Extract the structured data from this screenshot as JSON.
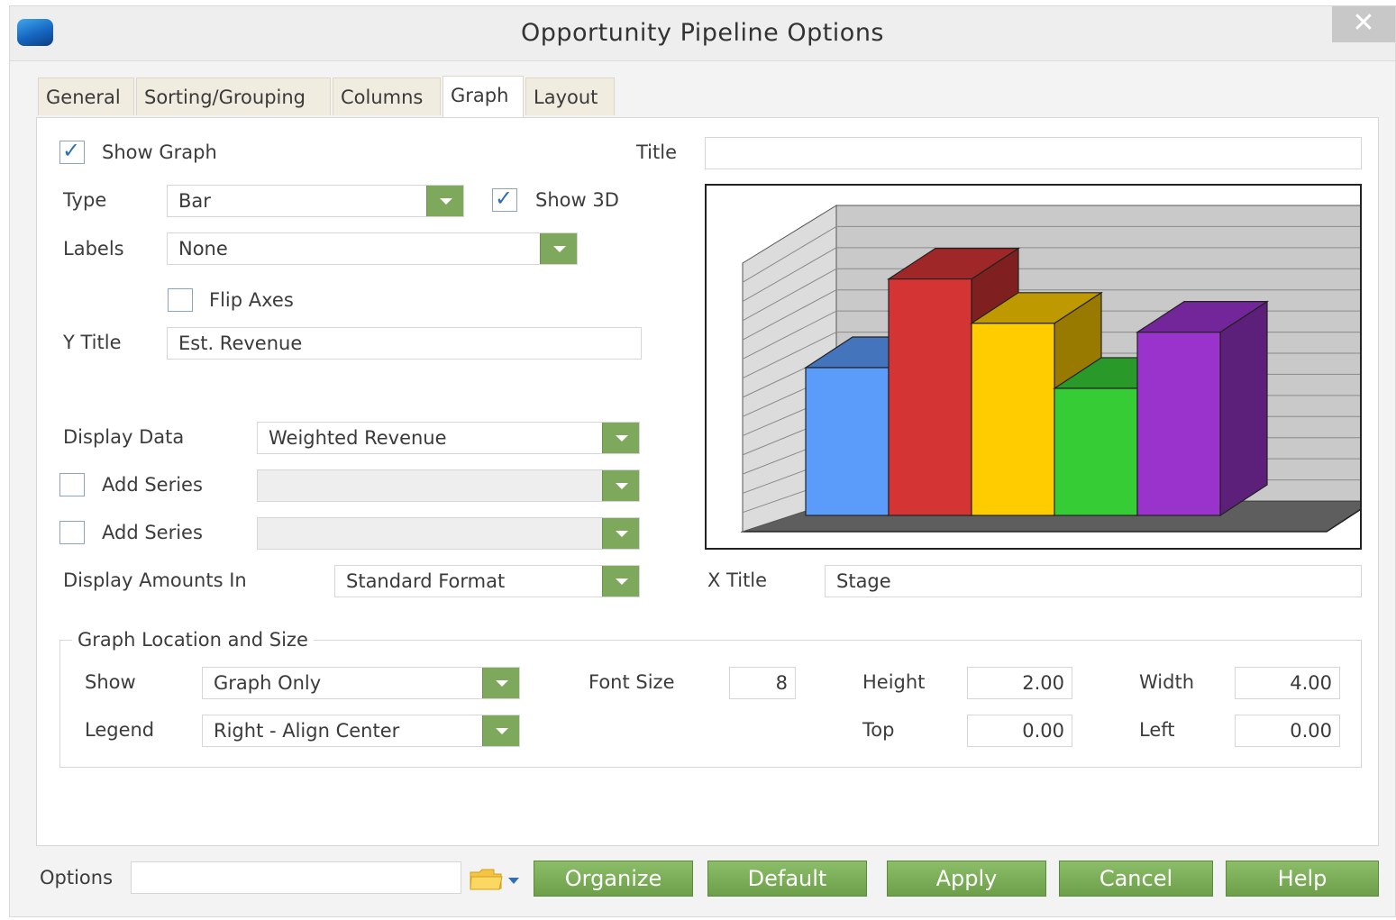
{
  "window": {
    "title": "Opportunity Pipeline Options",
    "close_glyph": "✕",
    "app_icon": "app-logo-icon"
  },
  "tabs": [
    {
      "label": "General",
      "active": false
    },
    {
      "label": "Sorting/Grouping",
      "active": false
    },
    {
      "label": "Columns",
      "active": false
    },
    {
      "label": "Graph",
      "active": true
    },
    {
      "label": "Layout",
      "active": false
    }
  ],
  "graph": {
    "show_graph_label": "Show Graph",
    "show_graph_checked": true,
    "title_label": "Title",
    "title_value": "",
    "type_label": "Type",
    "type_value": "Bar",
    "show3d_label": "Show 3D",
    "show3d_checked": true,
    "labels_label": "Labels",
    "labels_value": "None",
    "flip_axes_label": "Flip Axes",
    "flip_axes_checked": false,
    "ytitle_label": "Y Title",
    "ytitle_value": "Est. Revenue",
    "display_data_label": "Display Data",
    "display_data_value": "Weighted Revenue",
    "add_series_1_label": "Add Series",
    "add_series_1_checked": false,
    "add_series_1_value": "",
    "add_series_2_label": "Add Series",
    "add_series_2_checked": false,
    "add_series_2_value": "",
    "display_amounts_label": "Display Amounts In",
    "display_amounts_value": "Standard Format",
    "xtitle_label": "X Title",
    "xtitle_value": "Stage"
  },
  "location": {
    "group_label": "Graph Location and Size",
    "show_label": "Show",
    "show_value": "Graph Only",
    "legend_label": "Legend",
    "legend_value": "Right - Align Center",
    "font_size_label": "Font Size",
    "font_size_value": "8",
    "height_label": "Height",
    "height_value": "2.00",
    "width_label": "Width",
    "width_value": "4.00",
    "top_label": "Top",
    "top_value": "0.00",
    "left_label": "Left",
    "left_value": "0.00"
  },
  "footer": {
    "options_label": "Options",
    "options_value": "",
    "folder_icon": "folder-icon",
    "buttons": {
      "organize": "Organize",
      "default": "Default",
      "apply": "Apply",
      "cancel": "Cancel",
      "help": "Help"
    }
  },
  "colors": {
    "accent_green": "#7ea85c",
    "bars": [
      "#5b9bfa",
      "#d43434",
      "#ffcc00",
      "#36cc36",
      "#9933cc"
    ]
  },
  "chart_data": {
    "type": "bar",
    "three_d": true,
    "values": [
      5,
      8,
      6.5,
      4.3,
      6.2
    ],
    "colors": [
      "#5b9bfa",
      "#d43434",
      "#ffcc00",
      "#36cc36",
      "#9933cc"
    ],
    "ylim": [
      0,
      10
    ],
    "grid": true
  }
}
